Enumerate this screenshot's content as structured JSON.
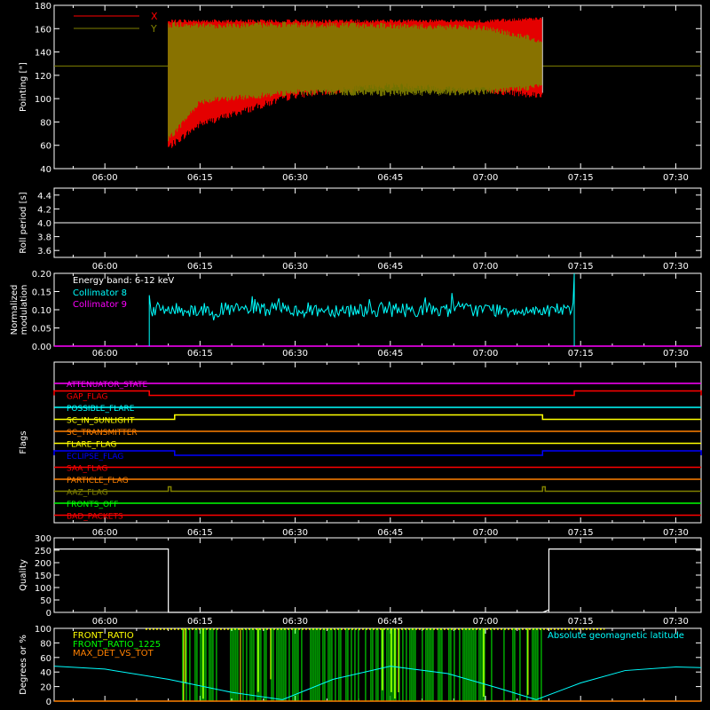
{
  "chart_data": [
    {
      "type": "line",
      "ylabel": "Pointing [\"]",
      "ylim": [
        40,
        180
      ],
      "yticks": [
        40,
        60,
        80,
        100,
        120,
        140,
        160,
        180
      ],
      "xlim": [
        "05:52",
        "07:34"
      ],
      "xtick_labels": [
        "06:00",
        "06:15",
        "06:30",
        "06:45",
        "07:00",
        "07:15",
        "07:30"
      ],
      "legend": "top-left",
      "series": [
        {
          "name": "X",
          "color": "#ff0000",
          "x": [
            "05:52",
            "06:10",
            "06:15",
            "06:30",
            "06:45",
            "07:00",
            "07:09",
            "07:34"
          ],
          "y_low": [
            128,
            55,
            75,
            100,
            108,
            104,
            100,
            128
          ],
          "y_high": [
            128,
            168,
            168,
            168,
            168,
            168,
            170,
            128
          ]
        },
        {
          "name": "Y",
          "color": "#808000",
          "x": [
            "05:52",
            "06:10",
            "06:15",
            "06:30",
            "06:45",
            "07:00",
            "07:09",
            "07:34"
          ],
          "y_low": [
            128,
            62,
            95,
            103,
            102,
            103,
            108,
            128
          ],
          "y_high": [
            128,
            166,
            165,
            166,
            165,
            163,
            152,
            128
          ]
        }
      ]
    },
    {
      "type": "line",
      "ylabel": "Roll period [s]",
      "ylim": [
        3.5,
        4.5
      ],
      "yticks": [
        3.6,
        3.8,
        4.0,
        4.2,
        4.4
      ],
      "ytick_labels": [
        "3.6",
        "3.8",
        "4.0",
        "4.2",
        "4.4"
      ],
      "xtick_labels": [
        "06:00",
        "06:15",
        "06:30",
        "06:45",
        "07:00",
        "07:15",
        "07:30"
      ],
      "series": [
        {
          "name": "",
          "color": "#ffffff",
          "x": [
            "05:52",
            "07:34"
          ],
          "y": [
            4.0,
            4.0
          ]
        }
      ]
    },
    {
      "type": "line",
      "ylabel": [
        "Normalized",
        "modulation"
      ],
      "ylim": [
        0,
        0.2
      ],
      "yticks": [
        0,
        0.05,
        0.1,
        0.15,
        0.2
      ],
      "ytick_labels": [
        "0.00",
        "0.05",
        "0.10",
        "0.15",
        "0.20"
      ],
      "xtick_labels": [
        "06:00",
        "06:15",
        "06:30",
        "06:45",
        "07:00",
        "07:15",
        "07:30"
      ],
      "annotation": "Energy band: 6-12 keV",
      "legend": "top-left",
      "series": [
        {
          "name": "Collimator 8",
          "color": "#00ffff",
          "x": [
            "06:07",
            "07:14"
          ],
          "y_mean": 0.1,
          "y_spread": 0.02,
          "y_max": 0.2
        },
        {
          "name": "Collimator 9",
          "color": "#ff00ff",
          "x": [
            "05:52",
            "07:34"
          ],
          "y": [
            0,
            0
          ]
        }
      ]
    },
    {
      "type": "line",
      "ylabel": "Flags",
      "xtick_labels": [
        "06:00",
        "06:15",
        "06:30",
        "06:45",
        "07:00",
        "07:15",
        "07:30"
      ],
      "flags": [
        {
          "name": "ATTENUATOR_STATE",
          "color": "#ff00ff",
          "on": []
        },
        {
          "name": "GAP_FLAG",
          "color": "#ff0000",
          "on": [
            [
              "05:52",
              "06:07"
            ],
            [
              "07:14",
              "07:34"
            ]
          ]
        },
        {
          "name": "POSSIBLE_FLARE",
          "color": "#00ffff",
          "on": []
        },
        {
          "name": "SC_IN_SUNLIGHT",
          "color": "#ffff00",
          "on": [
            [
              "06:11",
              "07:09"
            ]
          ]
        },
        {
          "name": "SC_TRANSMITTER",
          "color": "#ff8000",
          "on": []
        },
        {
          "name": "FLARE_FLAG",
          "color": "#ffff00",
          "on": []
        },
        {
          "name": "ECLIPSE_FLAG",
          "color": "#0000ff",
          "on": [
            [
              "05:52",
              "06:11"
            ],
            [
              "07:09",
              "07:34"
            ]
          ]
        },
        {
          "name": "SAA_FLAG",
          "color": "#ff0000",
          "on": []
        },
        {
          "name": "PARTICLE_FLAG",
          "color": "#ff8000",
          "on": []
        },
        {
          "name": "AAZ_FLAG",
          "color": "#808000",
          "on": [
            [
              "06:10",
              "06:10"
            ],
            [
              "07:09",
              "07:09"
            ]
          ]
        },
        {
          "name": "FRONTS_OFF",
          "color": "#00ff00",
          "on": []
        },
        {
          "name": "BAD_PACKETS",
          "color": "#ff0000",
          "on": []
        }
      ]
    },
    {
      "type": "line",
      "ylabel": "Quality",
      "ylim": [
        0,
        300
      ],
      "yticks": [
        0,
        50,
        100,
        150,
        200,
        250,
        300
      ],
      "ytick_labels": [
        "0",
        "50",
        "100",
        "150",
        "200",
        "250",
        "300"
      ],
      "xtick_labels": [
        "06:00",
        "06:15",
        "06:30",
        "06:45",
        "07:00",
        "07:15",
        "07:30"
      ],
      "series": [
        {
          "name": "",
          "color": "#ffffff",
          "x": [
            "05:52",
            "06:10",
            "06:10",
            "07:09",
            "07:10",
            "07:10",
            "07:34"
          ],
          "y": [
            255,
            255,
            0,
            0,
            10,
            255,
            255
          ]
        }
      ]
    },
    {
      "type": "line",
      "ylabel": "Degrees or %",
      "ylim": [
        0,
        100
      ],
      "yticks": [
        0,
        20,
        40,
        60,
        80,
        100
      ],
      "ytick_labels": [
        "0",
        "20",
        "40",
        "60",
        "80",
        "100"
      ],
      "legend": "top-left",
      "series": [
        {
          "name": "FRONT_RATIO",
          "color": "#ffff00",
          "x": [
            "06:12",
            "07:09"
          ],
          "y_high": 100
        },
        {
          "name": "FRONT_RATIO_1225",
          "color": "#00ff00",
          "x": [
            "06:12",
            "07:09"
          ],
          "y_high": 100
        },
        {
          "name": "MAX_DET_VS_TOT",
          "color": "#ff8000",
          "x": [
            "05:52",
            "07:34"
          ],
          "y": [
            0,
            0
          ]
        },
        {
          "name": "Absolute geomagnetic latitude",
          "color": "#00ffff",
          "x": [
            "05:52",
            "06:00",
            "06:10",
            "06:20",
            "06:28",
            "06:36",
            "06:45",
            "06:54",
            "07:02",
            "07:08",
            "07:15",
            "07:22",
            "07:30",
            "07:34"
          ],
          "y": [
            48,
            44,
            30,
            12,
            2,
            30,
            48,
            38,
            18,
            2,
            25,
            42,
            47,
            46
          ]
        }
      ]
    }
  ]
}
